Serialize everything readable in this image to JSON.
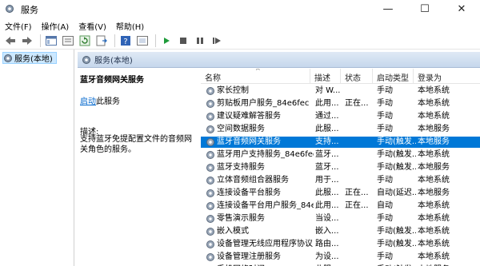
{
  "window": {
    "title": "服务",
    "minimize_glyph": "—",
    "maximize_glyph": "☐",
    "close_glyph": "✕"
  },
  "menu": [
    "文件(F)",
    "操作(A)",
    "查看(V)",
    "帮助(H)"
  ],
  "toolbar_icons": [
    "back-icon",
    "forward-icon",
    "console-tree-icon",
    "properties-icon",
    "refresh-icon",
    "export-icon",
    "help-icon",
    "details-icon",
    "start-icon",
    "stop-icon",
    "pause-icon",
    "restart-icon"
  ],
  "tree": {
    "item": "服务(本地)"
  },
  "right_header": {
    "title": "服务(本地)"
  },
  "description": {
    "service_name": "蓝牙音频网关服务",
    "start_link": "启动",
    "start_suffix": "此服务",
    "label": "描述:",
    "text": "支持蓝牙免提配置文件的音频网关角色的服务。"
  },
  "columns": [
    "名称",
    "描述",
    "状态",
    "启动类型",
    "登录为"
  ],
  "sort_arrow": "^",
  "services": [
    {
      "name": "家长控制",
      "desc": "对 W...",
      "status": "",
      "startup": "手动",
      "logon": "本地系统"
    },
    {
      "name": "剪贴板用户服务_84e6fec",
      "desc": "此用...",
      "status": "正在...",
      "startup": "手动",
      "logon": "本地系统"
    },
    {
      "name": "建议疑难解答服务",
      "desc": "通过...",
      "status": "",
      "startup": "手动",
      "logon": "本地系统"
    },
    {
      "name": "空间数据服务",
      "desc": "此服...",
      "status": "",
      "startup": "手动",
      "logon": "本地服务"
    },
    {
      "name": "蓝牙音频网关服务",
      "desc": "支持...",
      "status": "",
      "startup": "手动(触发...",
      "logon": "本地服务"
    },
    {
      "name": "蓝牙用户支持服务_84e6fec",
      "desc": "蓝牙...",
      "status": "",
      "startup": "手动(触发...",
      "logon": "本地系统"
    },
    {
      "name": "蓝牙支持服务",
      "desc": "蓝牙...",
      "status": "",
      "startup": "手动(触发...",
      "logon": "本地服务"
    },
    {
      "name": "立体音频组合器服务",
      "desc": "用于...",
      "status": "",
      "startup": "手动",
      "logon": "本地系统"
    },
    {
      "name": "连接设备平台服务",
      "desc": "此服...",
      "status": "正在...",
      "startup": "自动(延迟...",
      "logon": "本地服务"
    },
    {
      "name": "连接设备平台用户服务_84e6...",
      "desc": "此用...",
      "status": "正在...",
      "startup": "自动",
      "logon": "本地系统"
    },
    {
      "name": "零售演示服务",
      "desc": "当设...",
      "status": "",
      "startup": "手动",
      "logon": "本地系统"
    },
    {
      "name": "嵌入模式",
      "desc": "嵌入...",
      "status": "",
      "startup": "手动(触发...",
      "logon": "本地系统"
    },
    {
      "name": "设备管理无线应用程序协议...",
      "desc": "路由...",
      "status": "",
      "startup": "手动(触发...",
      "logon": "本地系统"
    },
    {
      "name": "设备管理注册服务",
      "desc": "为设...",
      "status": "",
      "startup": "手动",
      "logon": "本地系统"
    },
    {
      "name": "手机网络时间",
      "desc": "此服...",
      "status": "",
      "startup": "手动(触发...",
      "logon": "本地服务"
    }
  ],
  "selected_index": 4,
  "colors": {
    "selection": "#0078d7",
    "link": "#0066cc",
    "tree_highlight": "#cce8ff"
  }
}
